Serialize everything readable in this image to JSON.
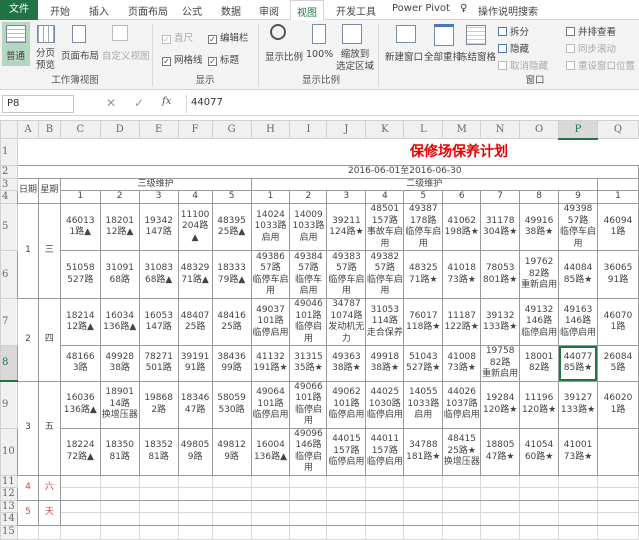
{
  "tabs": [
    "文件",
    "开始",
    "插入",
    "页面布局",
    "公式",
    "数据",
    "审阅",
    "视图",
    "开发工具",
    "Power Pivot",
    "操作说明搜索"
  ],
  "ribbon": {
    "workbook_views": {
      "normal": "普通",
      "page_break": "分页\n预览",
      "page_layout": "页面布局",
      "custom": "自定义视图",
      "group": "工作簿视图"
    },
    "show": {
      "ruler": "直尺",
      "formula_bar": "编辑栏",
      "gridlines": "网格线",
      "headings": "标题",
      "group": "显示"
    },
    "zoom": {
      "zoom": "显示比例",
      "hundred": "100%",
      "zoom_sel": "缩放到\n选定区域",
      "group": "显示比例"
    },
    "window": {
      "new": "新建窗口",
      "arrange": "全部重排",
      "freeze": "冻结窗格",
      "split": "拆分",
      "hide": "隐藏",
      "unhide": "取消隐藏",
      "side": "并排查看",
      "sync": "同步滚动",
      "reset": "重设窗口位置",
      "group": "窗口"
    }
  },
  "formula_bar": {
    "name_box": "P8",
    "value": "44077"
  },
  "sheet": {
    "columns": [
      "A",
      "B",
      "C",
      "D",
      "E",
      "F",
      "G",
      "H",
      "I",
      "J",
      "K",
      "L",
      "M",
      "N",
      "O",
      "P",
      "Q"
    ],
    "title": "保修场保养计划",
    "date_range": "2016-06-01至2016-06-30",
    "h_date": "日期",
    "h_week": "星期",
    "level3": "三级维护",
    "level2": "二级维护",
    "sub3": [
      "1",
      "2",
      "3",
      "4",
      "5"
    ],
    "sub2": [
      "1",
      "2",
      "3",
      "4",
      "5",
      "6",
      "7",
      "8",
      "9"
    ],
    "subq": "1",
    "days": [
      {
        "date": "1",
        "week": "三",
        "rows": [
          [
            "46013\n1路▲",
            "18201\n12路▲",
            "19342\n147路",
            "11100\n204路▲",
            "48395\n25路▲",
            "14024\n1033路\n启用",
            "14009\n1033路\n启用",
            "39211\n124路★",
            "48501\n157路\n事故车启用",
            "49387\n178路\n临停车启用",
            "41062\n198路★",
            "31178\n304路★",
            "49916\n38路★",
            "49398\n57路\n临停车启用",
            "46094\n1路"
          ],
          [
            "51058\n527路",
            "31091\n68路",
            "31083\n68路▲",
            "48329\n71路▲",
            "18333\n79路▲",
            "49386\n57路\n临停车启用",
            "49384\n57路\n临停车启用",
            "49383\n57路\n临停车启用",
            "49382\n57路\n临停车启用",
            "48325\n71路★",
            "41018\n73路★",
            "78053\n801路★",
            "19762\n82路\n重新启用",
            "44084\n85路★",
            "36065\n91路"
          ]
        ]
      },
      {
        "date": "2",
        "week": "四",
        "rows": [
          [
            "18214\n12路▲",
            "16034\n136路▲",
            "16053\n147路",
            "48407\n25路",
            "48416\n25路",
            "49037\n101路\n临停启用",
            "49046\n101路\n临停启用",
            "34787\n1074路\n发动机无力",
            "31053\n114路\n走合保养",
            "76017\n118路★",
            "11187\n122路★",
            "39132\n133路★",
            "49132\n146路\n临停启用",
            "49163\n146路\n临停启用",
            "46070\n1路"
          ],
          [
            "48166\n3路",
            "49928\n38路",
            "78271\n501路",
            "39191\n91路",
            "38436\n99路",
            "41132\n191路★",
            "31315\n35路★",
            "49363\n38路★",
            "49918\n38路★",
            "51043\n527路★",
            "41008\n73路★",
            "19758\n82路\n重新启用",
            "18001\n82路",
            "44077\n85路★",
            "26084\n5路"
          ]
        ]
      },
      {
        "date": "3",
        "week": "五",
        "rows": [
          [
            "16036\n136路▲",
            "18901\n14路\n换增压器",
            "19868\n2路",
            "18346\n47路",
            "58059\n530路",
            "49064\n101路\n临停启用",
            "49066\n101路\n临停启用",
            "49062\n101路\n临停启用",
            "44025\n1030路\n临停启用",
            "14055\n1033路\n启用",
            "44026\n1037路\n临停启用",
            "19284\n120路★",
            "11196\n120路★",
            "39127\n133路★",
            "46020\n1路"
          ],
          [
            "18224\n72路▲",
            "18350\n81路",
            "18352\n81路",
            "49805\n9路",
            "49812\n9路",
            "16004\n136路▲",
            "49096\n146路\n临停启用",
            "44015\n157路\n临停启用",
            "44011\n157路\n临停启用",
            "34788\n181路★",
            "48415\n25路★\n换增压器",
            "18805\n47路★",
            "41054\n60路★",
            "41001\n73路★",
            ""
          ]
        ]
      }
    ],
    "weekend": [
      {
        "date": "4",
        "week": "六"
      },
      {
        "date": "5",
        "week": "天"
      }
    ]
  }
}
